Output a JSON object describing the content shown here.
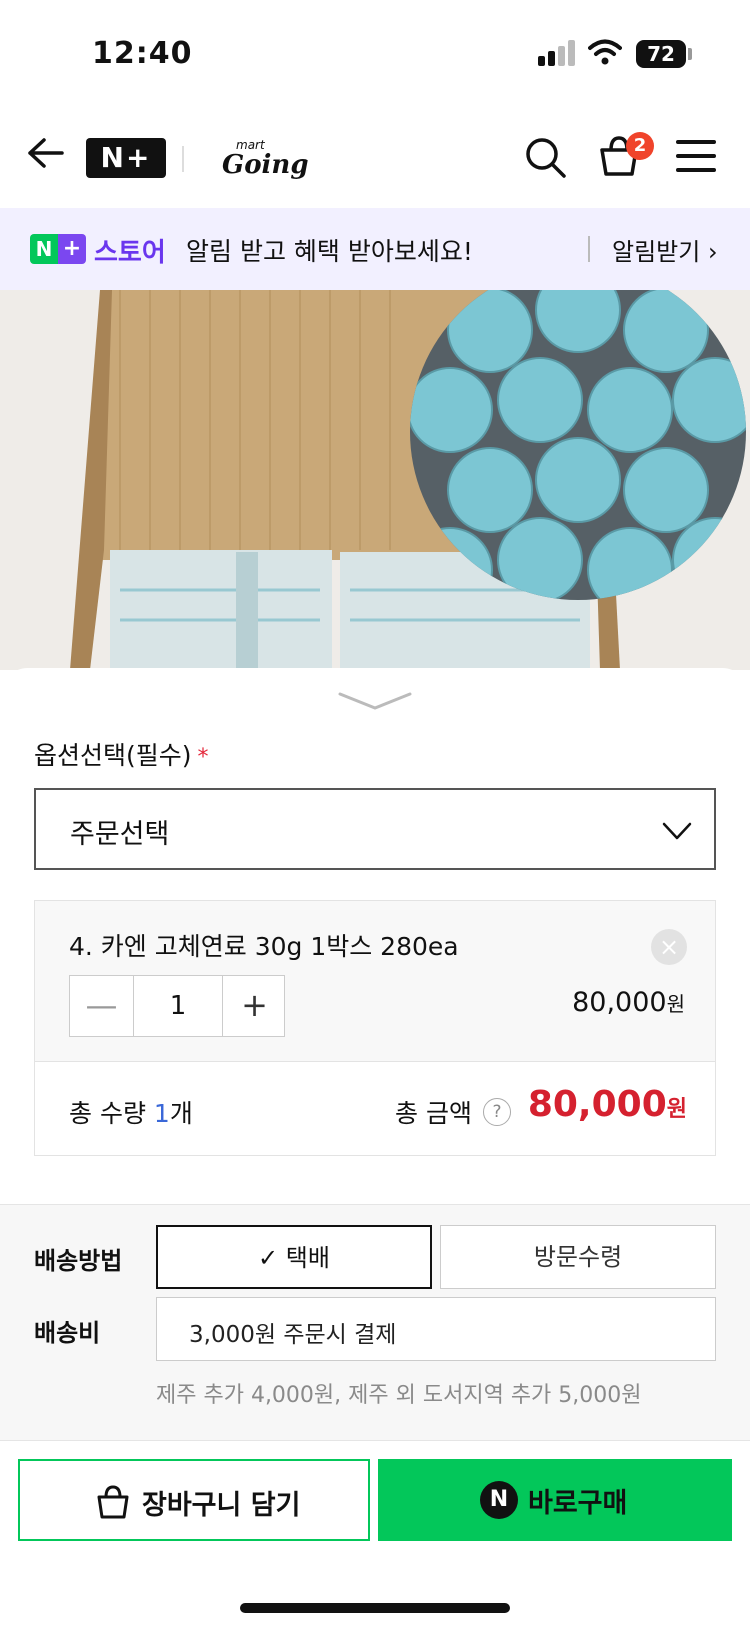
{
  "status_bar": {
    "time": "12:40",
    "battery": "72"
  },
  "header": {
    "logo_text": "N+",
    "brand_small": "mart",
    "brand": "Going",
    "cart_count": "2"
  },
  "promo": {
    "logo_badge_n": "N",
    "logo_badge_plus": "+",
    "store_word": "스토어",
    "message": "알림 받고 혜택 받아보세요!",
    "action": "알림받기 ›"
  },
  "option": {
    "label": "옵션선택(필수)",
    "required_mark": "*",
    "select_value": "주문선택",
    "item": {
      "name": "4. 카엔 고체연료 30g 1박스 280ea",
      "quantity": "1",
      "price": "80,000",
      "price_unit": "원",
      "remove_glyph": "×",
      "minus_glyph": "—",
      "plus_glyph": "+"
    },
    "total": {
      "qty_label": "총 수량",
      "qty_value": "1",
      "qty_unit": "개",
      "amount_label": "총 금액",
      "help_glyph": "?",
      "amount": "80,000",
      "amount_unit": "원"
    }
  },
  "delivery": {
    "method_label": "배송방법",
    "methods": [
      "✓ 택배",
      "방문수령"
    ],
    "selected_method": "✓ 택배",
    "fee_label": "배송비",
    "fee_value": "3,000원 주문시 결제",
    "fee_note": "제주 추가 4,000원, 제주 외 도서지역 추가 5,000원"
  },
  "actions": {
    "cart_button": "장바구니 담기",
    "buy_icon": "N",
    "buy_button": "바로구매"
  },
  "colors": {
    "naver_green": "#03c75a",
    "price_red": "#d5212f",
    "store_purple": "#6a36ee",
    "badge_red": "#f0442b"
  }
}
